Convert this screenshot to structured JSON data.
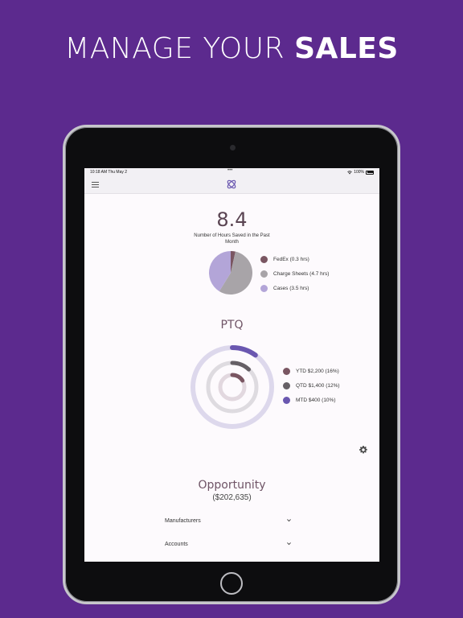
{
  "headline": {
    "regular": "MANAGE YOUR ",
    "bold": "SALES"
  },
  "statusbar": {
    "time": "10:18 AM   Thu May 2",
    "dots": "•••",
    "battery": "100%"
  },
  "hours": {
    "value": "8.4",
    "label": "Number of Hours Saved in the Past Month"
  },
  "hours_legend": [
    {
      "label": "FedEx (0.3 hrs)",
      "color": "#7a5662"
    },
    {
      "label": "Charge Sheets (4.7 hrs)",
      "color": "#a8a4a8"
    },
    {
      "label": "Cases (3.5 hrs)",
      "color": "#b3a5d8"
    }
  ],
  "ptq": {
    "title": "PTQ"
  },
  "ptq_legend": [
    {
      "label": "YTD $2,200 (16%)",
      "color": "#7a5662"
    },
    {
      "label": "QTD $1,400 (12%)",
      "color": "#666066"
    },
    {
      "label": "MTD $400 (10%)",
      "color": "#6a57b0"
    }
  ],
  "opportunity": {
    "title": "Opportunity",
    "value": "($202,635)"
  },
  "accordions": [
    {
      "label": "Manufacturers"
    },
    {
      "label": "Accounts"
    }
  ],
  "chart_data": [
    {
      "type": "pie",
      "title": "8.4",
      "subtitle": "Number of Hours Saved in the Past Month",
      "categories": [
        "FedEx",
        "Charge Sheets",
        "Cases"
      ],
      "values": [
        0.3,
        4.7,
        3.5
      ],
      "colors": [
        "#7a5662",
        "#a8a4a8",
        "#b3a5d8"
      ],
      "legend": "right"
    },
    {
      "type": "radial-progress",
      "title": "PTQ",
      "categories": [
        "YTD",
        "QTD",
        "MTD"
      ],
      "amounts": [
        "$2,200",
        "$1,400",
        "$400"
      ],
      "values": [
        16,
        12,
        10
      ],
      "colors": [
        "#7a5662",
        "#666066",
        "#6a57b0"
      ],
      "track_colors": [
        "#e2d8df",
        "#dedbe0",
        "#ddd8ec"
      ],
      "legend": "right"
    }
  ]
}
